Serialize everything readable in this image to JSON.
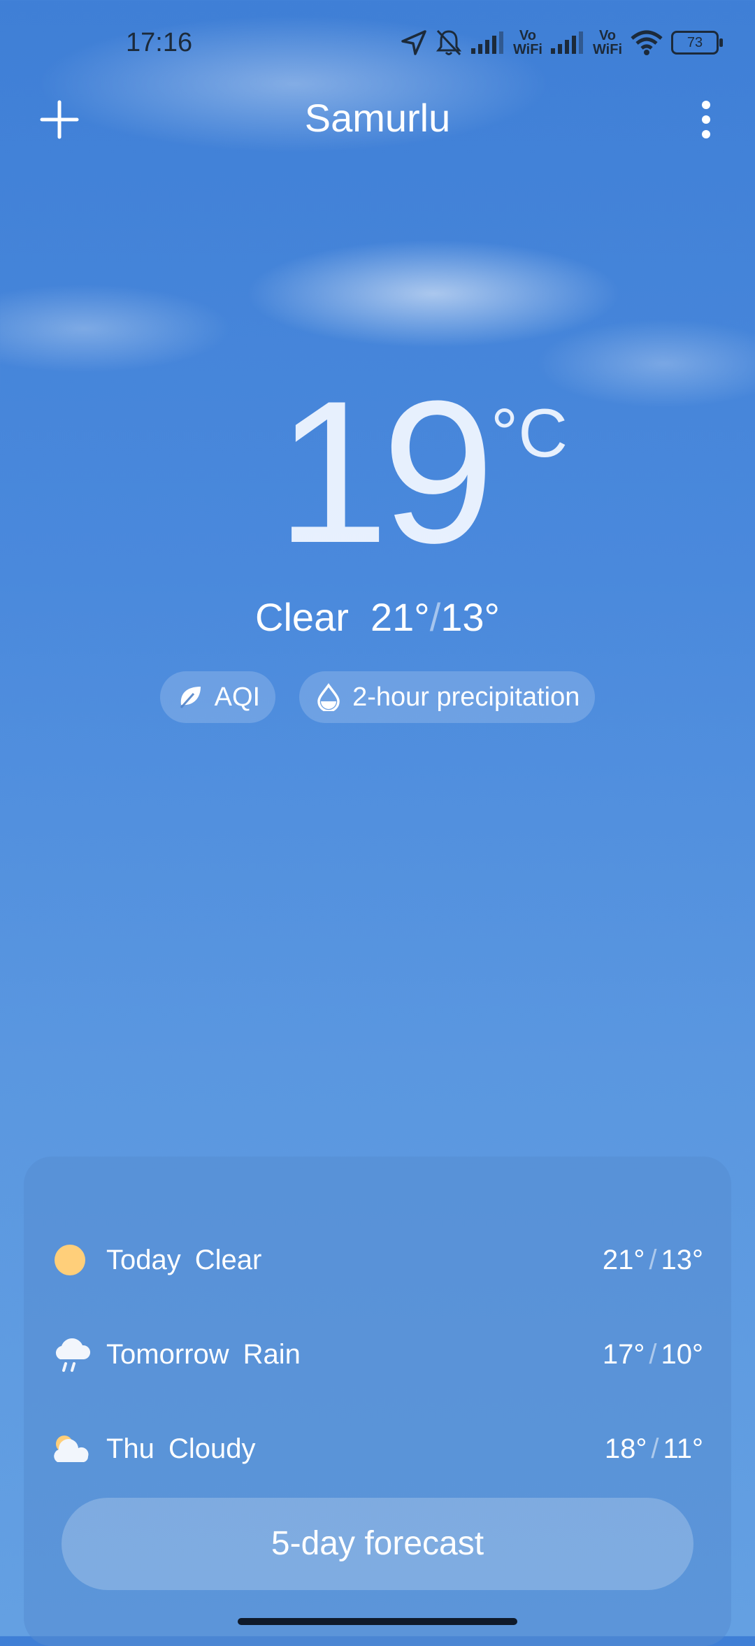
{
  "status": {
    "time": "17:16",
    "battery": "73",
    "vo_label_1": "Vo",
    "wifi_label_1": "WiFi",
    "vo_label_2": "Vo",
    "wifi_label_2": "WiFi"
  },
  "header": {
    "city": "Samurlu"
  },
  "current": {
    "temperature": "19",
    "unit": "°C",
    "condition": "Clear",
    "high": "21°",
    "low": "13°"
  },
  "chips": {
    "aqi_label": "AQI",
    "precip_label": "2-hour precipitation"
  },
  "forecast": {
    "rows": [
      {
        "day": "Today",
        "condition": "Clear",
        "high": "21°",
        "low": "13°",
        "icon": "sun-icon"
      },
      {
        "day": "Tomorrow",
        "condition": "Rain",
        "high": "17°",
        "low": "10°",
        "icon": "rain-icon"
      },
      {
        "day": "Thu",
        "condition": "Cloudy",
        "high": "18°",
        "low": "11°",
        "icon": "partly-cloudy-icon"
      }
    ],
    "button_label": "5-day forecast"
  }
}
